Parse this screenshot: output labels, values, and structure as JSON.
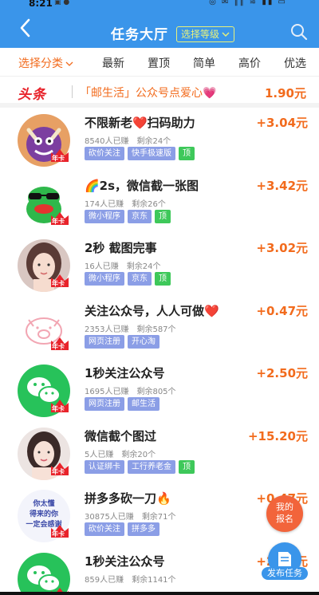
{
  "status_bar": {
    "time": "8:21",
    "left_icons": "▣ ●",
    "right_icons": "◎ ✉ ‖‖ ≋ ▮▮ ▭"
  },
  "header": {
    "title": "任务大厅",
    "level_button": "选择等级"
  },
  "tabs": [
    {
      "label": "选择分类",
      "active": true
    },
    {
      "label": "最新"
    },
    {
      "label": "置顶"
    },
    {
      "label": "简单"
    },
    {
      "label": "高价"
    },
    {
      "label": "优选"
    }
  ],
  "headline": {
    "tag": "头条",
    "text": "「邮生活」公众号点爱心💗",
    "price": "1.90元"
  },
  "tasks": [
    {
      "name": "不限新老❤️扫码助力",
      "earned": "8540人已赚",
      "remaining": "剩余24个",
      "reward": "+3.04元",
      "chips": [
        "砍价关注",
        "快手极速版"
      ],
      "top": "顶",
      "avatar": "monster"
    },
    {
      "name": "🌈2s，微信截一张图",
      "earned": "174人已赚",
      "remaining": "剩余26个",
      "reward": "+3.42元",
      "chips": [
        "微小程序",
        "京东"
      ],
      "top": "顶",
      "avatar": "frog"
    },
    {
      "name": "2秒 截图完事",
      "earned": "16人已赚",
      "remaining": "剩余24个",
      "reward": "+3.02元",
      "chips": [
        "微小程序",
        "京东"
      ],
      "top": "顶",
      "avatar": "girl"
    },
    {
      "name": "关注公众号，人人可做❤️",
      "earned": "2353人已赚",
      "remaining": "剩余587个",
      "reward": "+0.47元",
      "chips": [
        "网页注册",
        "开心淘"
      ],
      "top": "",
      "avatar": "pig"
    },
    {
      "name": "1秒关注公众号",
      "earned": "1695人已赚",
      "remaining": "剩余805个",
      "reward": "+2.50元",
      "chips": [
        "网页注册",
        "邮生活"
      ],
      "top": "",
      "avatar": "wechat"
    },
    {
      "name": "微信截个图过",
      "earned": "5人已赚",
      "remaining": "剩余20个",
      "reward": "+15.20元",
      "chips": [
        "认证绑卡",
        "工行养老金"
      ],
      "top": "顶",
      "avatar": "woman"
    },
    {
      "name": "拼多多砍一刀🔥",
      "earned": "30875人已赚",
      "remaining": "剩余71个",
      "reward": "+0.47元",
      "chips": [
        "砍价关注",
        "拼多多"
      ],
      "top": "",
      "avatar": "text"
    },
    {
      "name": "1秒关注公众号",
      "earned": "859人已赚",
      "remaining": "剩余1141个",
      "reward": "+2.50元",
      "chips": [],
      "top": "",
      "avatar": "wechat"
    }
  ],
  "avatar_text": "你太懂\n得来的你\n一定会感谢",
  "badge_text": "年卡",
  "float": {
    "signup": "我的\n报名",
    "publish": "发布任务"
  },
  "colors": {
    "brand_blue": "#3a95ea",
    "accent_orange": "#f26b1d",
    "chip_blue": "#8b9ee6",
    "chip_green": "#3ec85a",
    "headline_red": "#e8232b"
  }
}
